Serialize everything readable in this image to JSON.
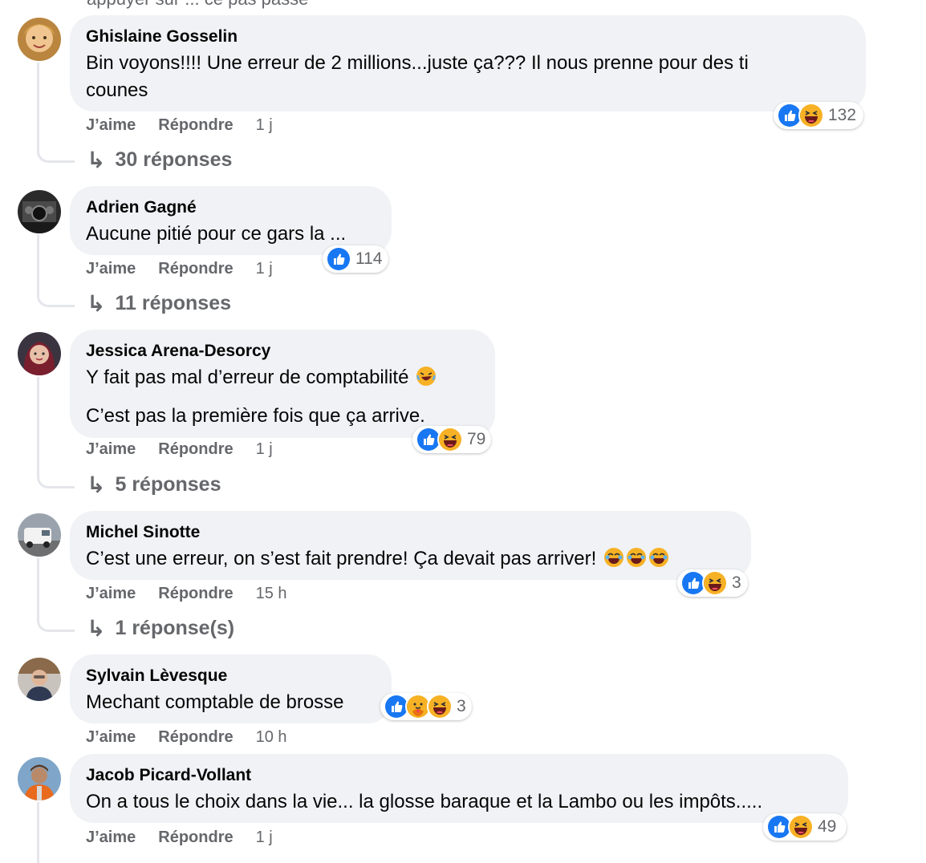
{
  "top_cut_text": "appuyer sur ... ce pas passé",
  "comments": [
    {
      "author": "Ghislaine Gosselin",
      "lines": [
        "Bin voyons!!!! Une erreur de 2 millions...juste ça??? Il nous prenne pour des ti",
        "counes"
      ],
      "reactions": [
        "like",
        "haha"
      ],
      "reaction_count": "132",
      "like_label": "J’aime",
      "reply_label": "Répondre",
      "time": "1 j",
      "replies_label": "30 réponses"
    },
    {
      "author": "Adrien Gagné",
      "lines": [
        "Aucune pitié pour ce gars la ..."
      ],
      "reactions": [
        "like"
      ],
      "reaction_count": "114",
      "like_label": "J’aime",
      "reply_label": "Répondre",
      "time": "1 j",
      "replies_label": "11 réponses"
    },
    {
      "author": "Jessica Arena-Desorcy",
      "lines": [
        "Y fait pas mal d’erreur de comptabilité",
        "C’est pas la première fois que ça arrive."
      ],
      "reactions": [
        "like",
        "haha"
      ],
      "reaction_count": "79",
      "like_label": "J’aime",
      "reply_label": "Répondre",
      "time": "1 j",
      "replies_label": "5 réponses"
    },
    {
      "author": "Michel Sinotte",
      "lines": [
        "C’est une erreur, on s’est fait prendre! Ça devait pas arriver!"
      ],
      "reactions": [
        "like",
        "haha"
      ],
      "reaction_count": "3",
      "like_label": "J’aime",
      "reply_label": "Répondre",
      "time": "15 h",
      "replies_label": "1 réponse(s)"
    },
    {
      "author": "Sylvain Lèvesque",
      "lines": [
        "Mechant comptable de brosse"
      ],
      "reactions": [
        "like",
        "care",
        "haha"
      ],
      "reaction_count": "3",
      "like_label": "J’aime",
      "reply_label": "Répondre",
      "time": "10 h"
    },
    {
      "author": "Jacob Picard-Vollant",
      "lines": [
        "On a tous le choix dans la vie... la glosse baraque et la Lambo ou les impôts....."
      ],
      "reactions": [
        "like",
        "haha"
      ],
      "reaction_count": "49",
      "like_label": "J’aime",
      "reply_label": "Répondre",
      "time": "1 j"
    }
  ],
  "colors": {
    "bubble": "#f0f2f5",
    "secondary_text": "#65676b",
    "like_blue": "#1877f2",
    "haha_yellow": "#f7b125"
  }
}
